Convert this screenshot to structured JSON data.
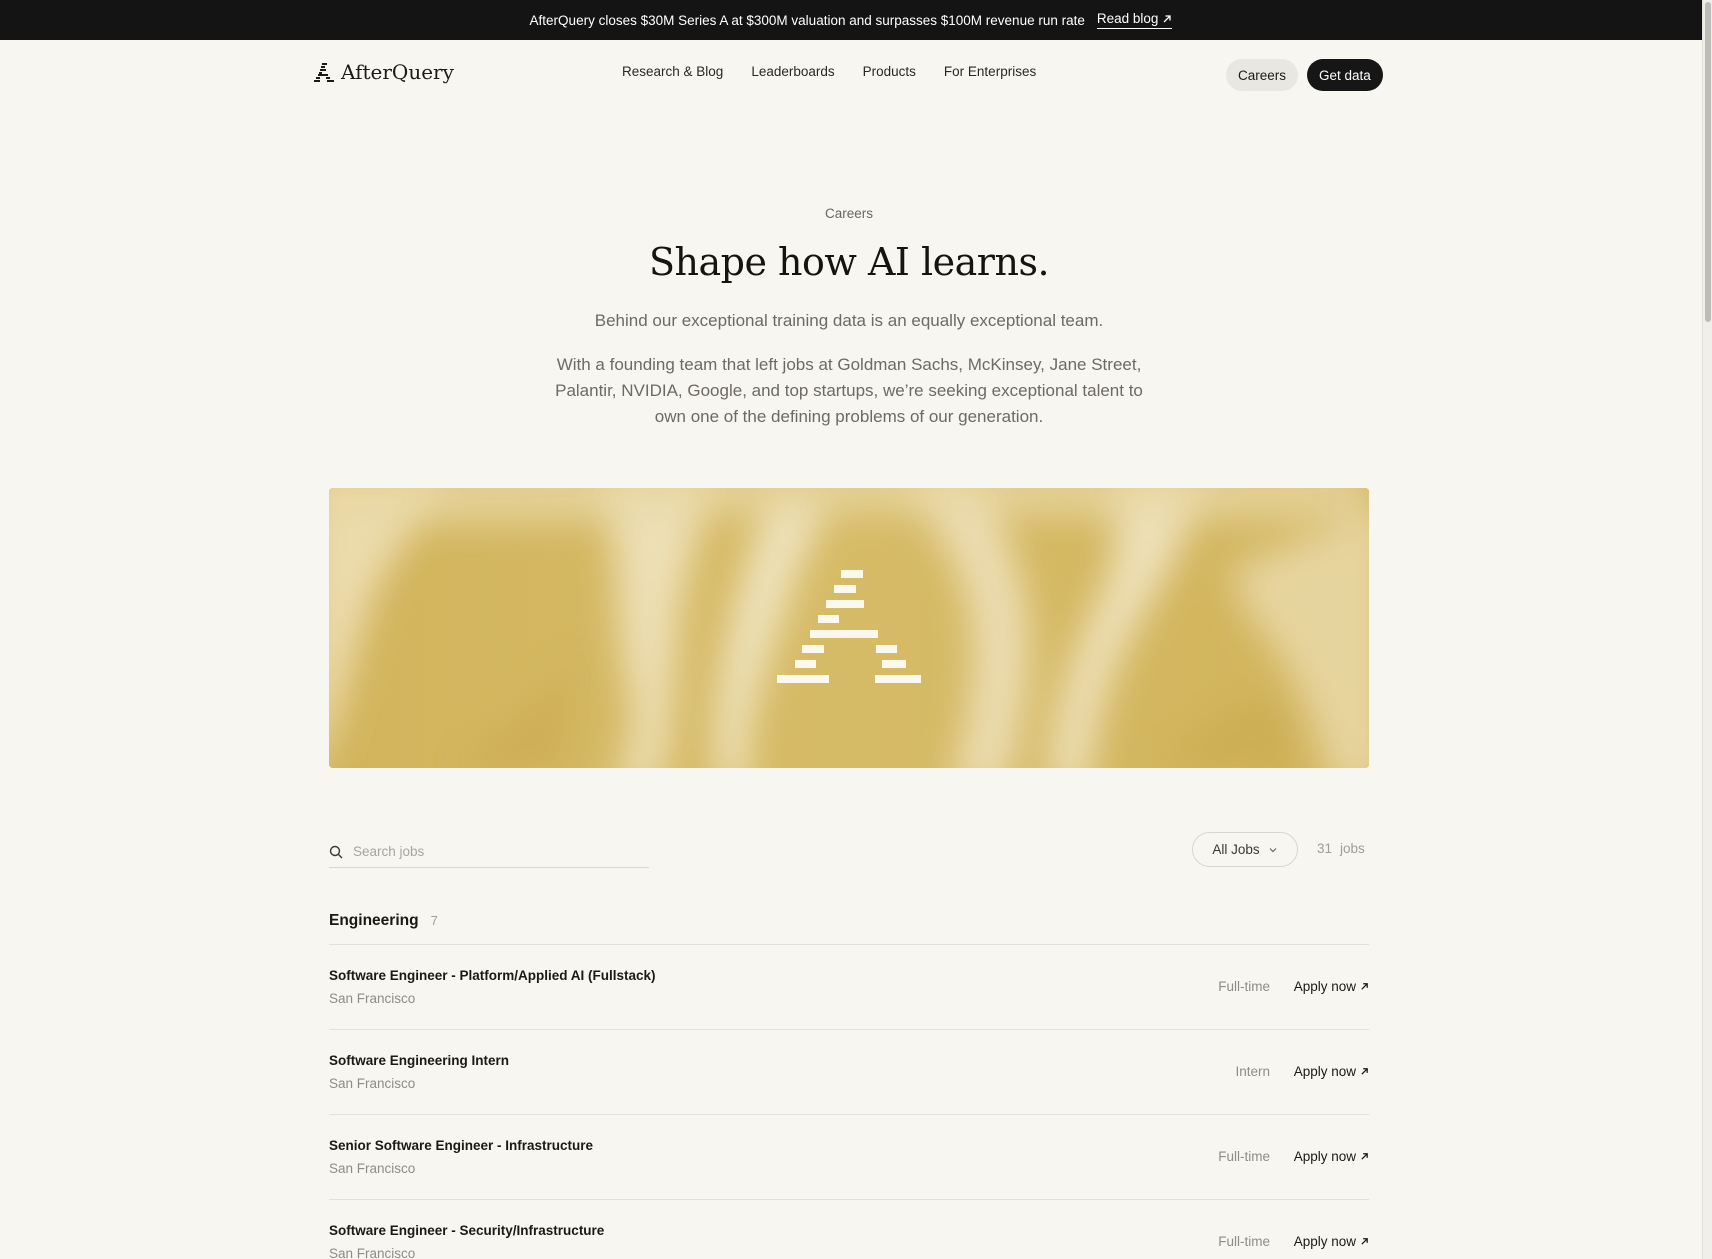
{
  "announcement": {
    "text": "AfterQuery closes $30M Series A at $300M valuation and surpasses $100M revenue run rate",
    "link_label": "Read blog"
  },
  "header": {
    "logo_text": "AfterQuery",
    "nav": [
      "Research & Blog",
      "Leaderboards",
      "Products",
      "For Enterprises"
    ],
    "careers_label": "Careers",
    "get_data_label": "Get data"
  },
  "hero": {
    "eyebrow": "Careers",
    "title": "Shape how AI learns.",
    "subtitle": "Behind our exceptional training data is an equally exceptional team.",
    "body": "With a founding team that left jobs at Goldman Sachs, McKinsey, Jane Street, Palantir, NVIDIA, Google, and top startups, we’re seeking exceptional talent to own one of the defining problems of our generation."
  },
  "jobs_toolbar": {
    "search_placeholder": "Search jobs",
    "filter_label": "All Jobs",
    "count_number": "31",
    "count_word": "jobs"
  },
  "section": {
    "name": "Engineering",
    "count": "7"
  },
  "jobs": [
    {
      "title": "Software Engineer - Platform/Applied AI (Fullstack)",
      "location": "San Francisco",
      "type": "Full-time",
      "apply": "Apply now"
    },
    {
      "title": "Software Engineering Intern",
      "location": "San Francisco",
      "type": "Intern",
      "apply": "Apply now"
    },
    {
      "title": "Senior Software Engineer - Infrastructure",
      "location": "San Francisco",
      "type": "Full-time",
      "apply": "Apply now"
    },
    {
      "title": "Software Engineer - Security/Infrastructure",
      "location": "San Francisco",
      "type": "Full-time",
      "apply": "Apply now"
    }
  ],
  "colors": {
    "banner_gold": "#d3b65f",
    "page_bg": "#f7f6f0",
    "dark": "#141414"
  },
  "icons": [
    "arrow-up-right-icon",
    "search-icon",
    "chevron-down-icon",
    "logo-mark-icon"
  ]
}
